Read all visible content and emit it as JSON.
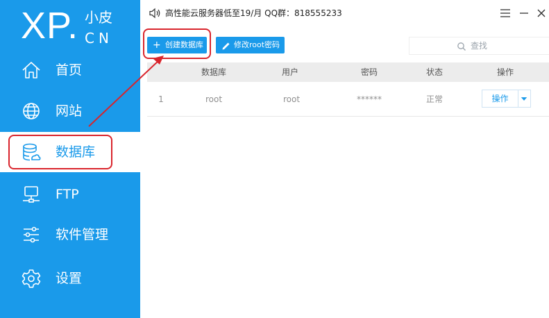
{
  "logo": {
    "main": "XP.",
    "sub": "小皮",
    "cn": "CN"
  },
  "sidebar": {
    "items": [
      {
        "label": "首页",
        "icon": "home-icon"
      },
      {
        "label": "网站",
        "icon": "globe-icon"
      },
      {
        "label": "数据库",
        "icon": "database-icon",
        "active": true
      },
      {
        "label": "FTP",
        "icon": "ftp-server-icon"
      },
      {
        "label": "软件管理",
        "icon": "sliders-icon"
      },
      {
        "label": "设置",
        "icon": "gear-icon"
      }
    ]
  },
  "titlebar": {
    "text": "高性能云服务器低至19/月  QQ群：818555233"
  },
  "toolbar": {
    "create_label": "创建数据库",
    "change_pwd_label": "修改root密码",
    "search_placeholder": "查找"
  },
  "table": {
    "headers": [
      "数据库",
      "用户",
      "密码",
      "状态",
      "操作"
    ],
    "rows": [
      {
        "index": "1",
        "database": "root",
        "user": "root",
        "password": "******",
        "status": "正常",
        "action": "操作"
      }
    ]
  },
  "colors": {
    "accent": "#1a9aea",
    "annotation": "#d9242c"
  }
}
